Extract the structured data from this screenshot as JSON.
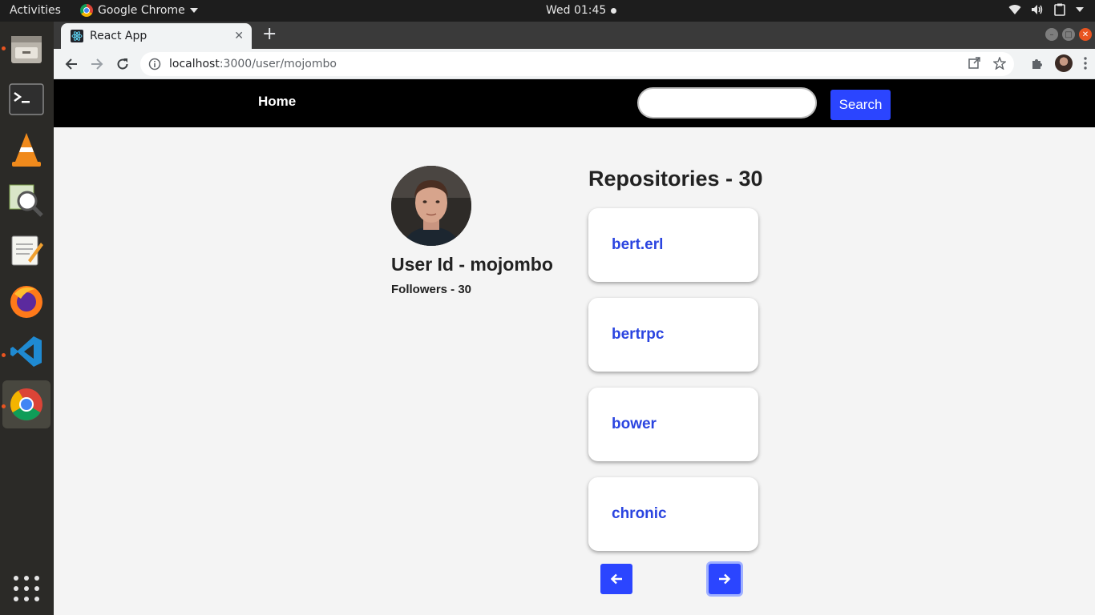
{
  "os": {
    "activities_label": "Activities",
    "app_menu_label": "Google Chrome",
    "clock": "Wed 01:45"
  },
  "browser": {
    "tab_title": "React App",
    "url_host": "localhost",
    "url_path": ":3000/user/mojombo"
  },
  "navbar": {
    "home_label": "Home",
    "search_placeholder": "",
    "search_button_label": "Search"
  },
  "profile": {
    "user_id": "User Id - mojombo",
    "followers": "Followers - 30"
  },
  "repositories": {
    "title": "Repositories - 30",
    "items": [
      {
        "name": "bert.erl"
      },
      {
        "name": "bertrpc"
      },
      {
        "name": "bower"
      },
      {
        "name": "chronic"
      }
    ]
  },
  "pagination": {
    "prev_icon": "arrow-left-icon",
    "next_icon": "arrow-right-icon"
  },
  "colors": {
    "accent": "#2b45ff",
    "repo_link": "#2b45e0",
    "navbar_bg": "#000000",
    "page_bg": "#f4f4f4"
  }
}
